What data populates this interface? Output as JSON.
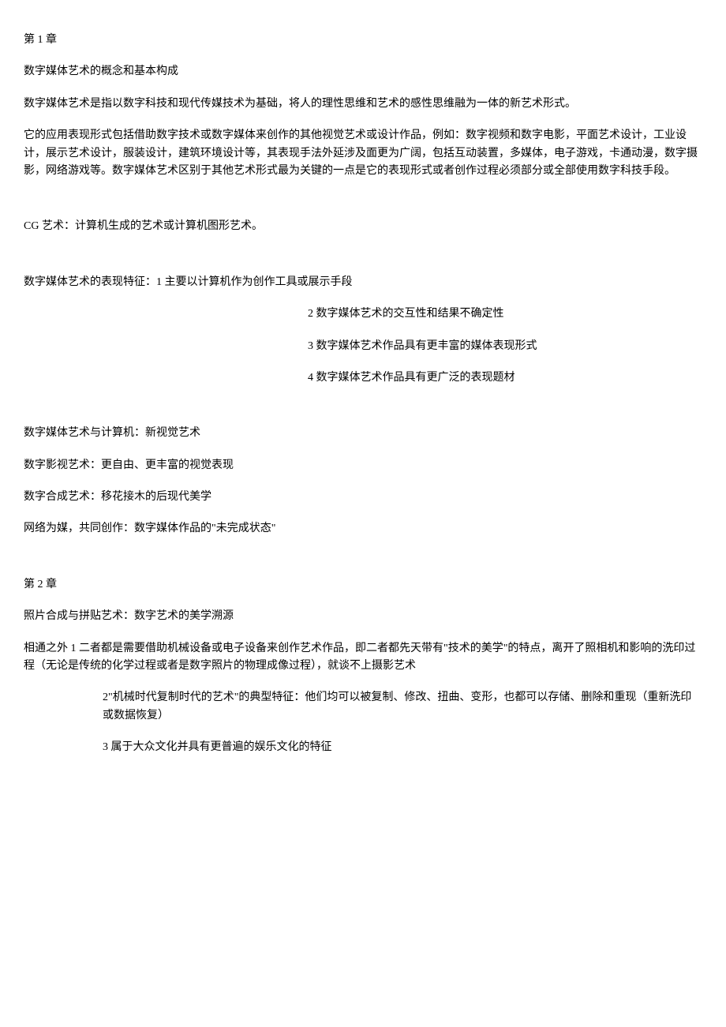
{
  "chapter1": {
    "title": "第 1 章",
    "heading": "数字媒体艺术的概念和基本构成",
    "intro": "数字媒体艺术是指以数字科技和现代传媒技术为基础，将人的理性思维和艺术的感性思维融为一体的新艺术形式。",
    "body": "它的应用表现形式包括借助数字技术或数字媒体来创作的其他视觉艺术或设计作品，例如：数字视频和数字电影，平面艺术设计，工业设计，展示艺术设计，服装设计，建筑环境设计等，其表现手法外延涉及面更为广阔，包括互动装置，多媒体，电子游戏，卡通动漫，数字摄影，网络游戏等。数字媒体艺术区别于其他艺术形式最为关键的一点是它的表现形式或者创作过程必须部分或全部使用数字科技手段。",
    "cg": "CG 艺术：计算机生成的艺术或计算机图形艺术。",
    "featLead": "数字媒体艺术的表现特征：1 主要以计算机作为创作工具或展示手段",
    "feat2": "2 数字媒体艺术的交互性和结果不确定性",
    "feat3": "3 数字媒体艺术作品具有更丰富的媒体表现形式",
    "feat4": "4 数字媒体艺术作品具有更广泛的表现题材",
    "line1": "数字媒体艺术与计算机：新视觉艺术",
    "line2": "数字影视艺术：更自由、更丰富的视觉表现",
    "line3": "数字合成艺术：移花接木的后现代美学",
    "line4": "网络为媒，共同创作：数字媒体作品的\"未完成状态\""
  },
  "chapter2": {
    "title": "第 2 章",
    "heading": "照片合成与拼贴艺术：数字艺术的美学溯源",
    "p1": "相通之外 1 二者都是需要借助机械设备或电子设备来创作艺术作品，即二者都先天带有\"技术的美学\"的特点，离开了照相机和影响的洗印过程（无论是传统的化学过程或者是数字照片的物理成像过程），就谈不上摄影艺术",
    "p2": "2\"机械时代复制时代的艺术\"的典型特征：他们均可以被复制、修改、扭曲、变形，也都可以存储、删除和重现（重新洗印或数据恢复）",
    "p3": "3 属于大众文化并具有更普遍的娱乐文化的特征"
  }
}
